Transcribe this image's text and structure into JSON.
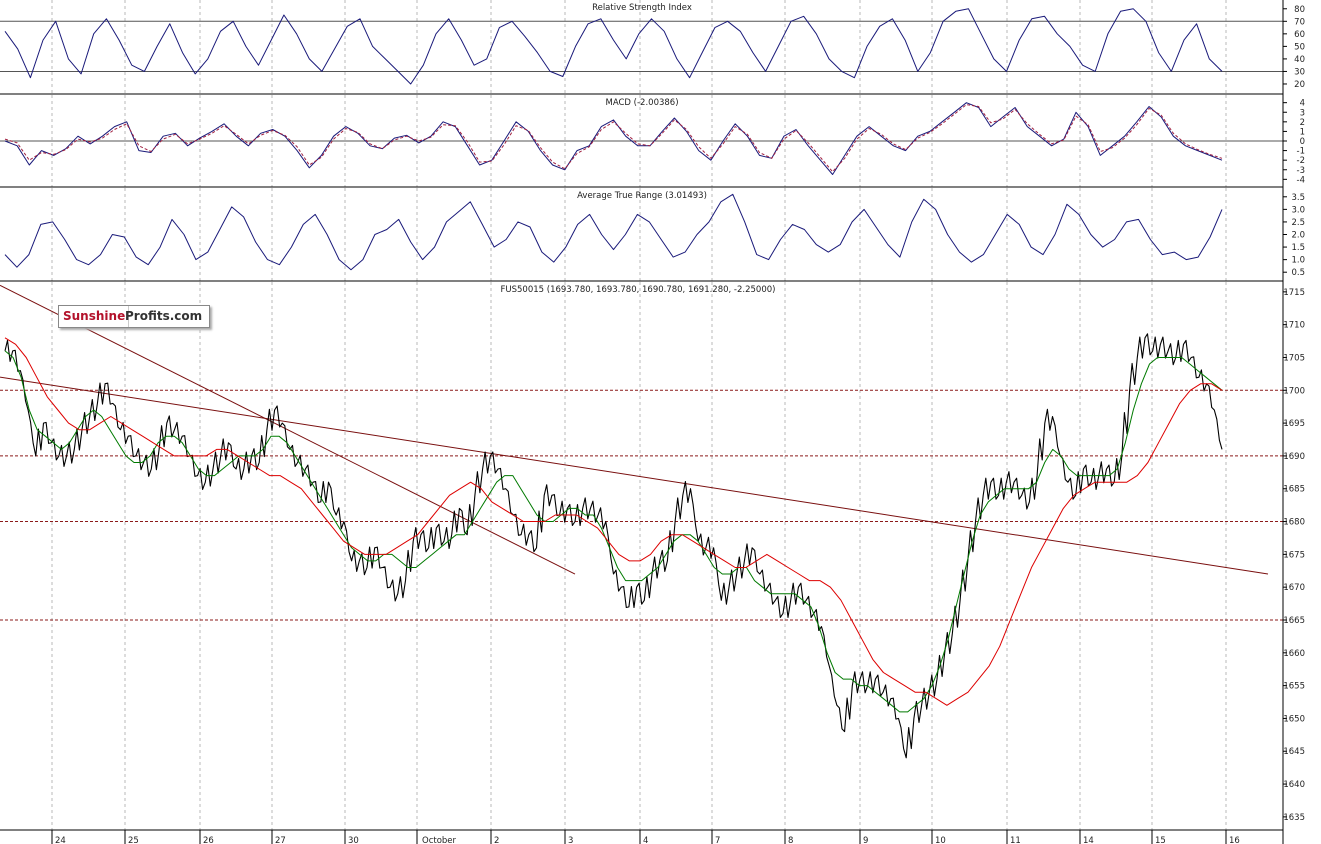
{
  "chart_data": [
    {
      "type": "line",
      "title": "Relative Strength Index",
      "yticks": [
        20,
        30,
        40,
        50,
        60,
        70,
        80
      ],
      "ylim": [
        12,
        87
      ],
      "reference_lines": [
        30,
        70
      ],
      "series": [
        {
          "color": "#1a1a7a",
          "values": [
            62,
            48,
            25,
            55,
            70,
            40,
            28,
            60,
            72,
            55,
            35,
            30,
            50,
            68,
            45,
            28,
            40,
            62,
            70,
            50,
            35,
            55,
            75,
            60,
            40,
            30,
            48,
            66,
            72,
            50,
            40,
            30,
            20,
            35,
            60,
            72,
            55,
            35,
            40,
            65,
            70,
            58,
            45,
            30,
            26,
            50,
            68,
            72,
            55,
            40,
            60,
            72,
            62,
            40,
            25,
            45,
            65,
            70,
            62,
            45,
            30,
            50,
            70,
            74,
            60,
            40,
            30,
            25,
            50,
            66,
            72,
            55,
            30,
            45,
            70,
            78,
            80,
            60,
            40,
            30,
            55,
            72,
            74,
            60,
            50,
            35,
            30,
            60,
            78,
            80,
            70,
            45,
            30,
            55,
            68,
            40,
            30
          ]
        }
      ]
    },
    {
      "type": "line",
      "title": "MACD (-2.00386)",
      "yticks": [
        -4,
        -3,
        -2,
        -1,
        0,
        1,
        2,
        3,
        4
      ],
      "ylim": [
        -4.8,
        4.8
      ],
      "reference_lines": [
        0
      ],
      "series": [
        {
          "color": "#1a1a7a",
          "values": [
            0,
            -0.5,
            -2.5,
            -1,
            -1.5,
            -0.8,
            0.5,
            -0.3,
            0.5,
            1.5,
            2,
            -1,
            -1.2,
            0.5,
            0.8,
            -0.5,
            0.3,
            1,
            1.8,
            0.5,
            -0.5,
            0.8,
            1.2,
            0.5,
            -1,
            -2.8,
            -1.5,
            0.5,
            1.5,
            0.8,
            -0.5,
            -0.8,
            0.3,
            0.6,
            -0.2,
            0.5,
            2,
            1.5,
            -0.5,
            -2.5,
            -2,
            0,
            2,
            1,
            -1,
            -2.5,
            -3,
            -1,
            -0.5,
            1.5,
            2.2,
            0.5,
            -0.5,
            -0.5,
            1,
            2.4,
            1,
            -1,
            -2,
            0,
            1.8,
            0.5,
            -1.5,
            -1.8,
            0.5,
            1.2,
            -0.5,
            -2,
            -3.5,
            -1.5,
            0.5,
            1.5,
            0.5,
            -0.5,
            -1,
            0.5,
            1,
            2,
            3,
            4,
            3.5,
            1.5,
            2.5,
            3.5,
            1.5,
            0.5,
            -0.5,
            0.2,
            3,
            1.5,
            -1.5,
            -0.5,
            0.5,
            2,
            3.6,
            2.5,
            0.5,
            -0.5,
            -1,
            -1.5,
            -2
          ]
        },
        {
          "color": "#a02040",
          "values": [
            0.2,
            -0.2,
            -2,
            -1.2,
            -1.4,
            -0.9,
            0.2,
            -0.1,
            0.3,
            1.2,
            1.8,
            -0.5,
            -1.1,
            0.2,
            0.7,
            -0.3,
            0.2,
            0.8,
            1.6,
            0.7,
            -0.3,
            0.6,
            1.1,
            0.6,
            -0.6,
            -2.5,
            -1.7,
            0.2,
            1.3,
            0.9,
            -0.3,
            -0.8,
            0.1,
            0.5,
            0,
            0.4,
            1.7,
            1.6,
            -0.1,
            -2.2,
            -2.1,
            -0.4,
            1.6,
            1.1,
            -0.7,
            -2.2,
            -2.9,
            -1.3,
            -0.6,
            1.2,
            2,
            0.8,
            -0.3,
            -0.5,
            0.8,
            2.2,
            1.2,
            -0.6,
            -1.8,
            -0.3,
            1.5,
            0.7,
            -1.2,
            -1.8,
            0.2,
            1.1,
            -0.2,
            -1.7,
            -3.2,
            -1.8,
            0.2,
            1.3,
            0.7,
            -0.3,
            -0.9,
            0.3,
            0.9,
            1.8,
            2.8,
            3.8,
            3.6,
            1.9,
            2.3,
            3.3,
            1.8,
            0.7,
            -0.3,
            0.1,
            2.6,
            1.7,
            -1.1,
            -0.7,
            0.3,
            1.7,
            3.4,
            2.7,
            0.8,
            -0.3,
            -0.9,
            -1.4,
            -1.8
          ]
        }
      ]
    },
    {
      "type": "line",
      "title": "Average True Range (3.01493)",
      "yticks": [
        0.5,
        1.0,
        1.5,
        2.0,
        2.5,
        3.0,
        3.5
      ],
      "ylim": [
        0.15,
        3.85
      ],
      "series": [
        {
          "color": "#1a1a7a",
          "values": [
            1.2,
            0.7,
            1.2,
            2.4,
            2.5,
            1.8,
            1.0,
            0.8,
            1.2,
            2.0,
            1.9,
            1.1,
            0.8,
            1.5,
            2.6,
            2.0,
            1.0,
            1.3,
            2.2,
            3.1,
            2.7,
            1.7,
            1.0,
            0.8,
            1.5,
            2.4,
            2.8,
            2.0,
            1.0,
            0.6,
            1.0,
            2.0,
            2.2,
            2.6,
            1.7,
            1.0,
            1.5,
            2.5,
            2.9,
            3.3,
            2.4,
            1.5,
            1.8,
            2.5,
            2.3,
            1.3,
            0.9,
            1.5,
            2.4,
            2.8,
            2.0,
            1.4,
            2.0,
            2.8,
            2.5,
            1.8,
            1.1,
            1.3,
            2.0,
            2.5,
            3.3,
            3.6,
            2.5,
            1.2,
            1.0,
            1.8,
            2.4,
            2.2,
            1.6,
            1.3,
            1.6,
            2.5,
            3.0,
            2.3,
            1.6,
            1.1,
            2.5,
            3.4,
            3.0,
            2.0,
            1.3,
            0.9,
            1.2,
            2.0,
            2.8,
            2.4,
            1.5,
            1.2,
            2.0,
            3.2,
            2.8,
            2.0,
            1.5,
            1.8,
            2.5,
            2.6,
            1.8,
            1.2,
            1.3,
            1.0,
            1.1,
            1.9,
            3.0
          ]
        }
      ]
    },
    {
      "type": "line",
      "title": "FUS50015 (1693.780, 1693.780, 1690.780, 1691.280, -2.25000)",
      "yticks": [
        1635,
        1640,
        1645,
        1650,
        1655,
        1660,
        1665,
        1670,
        1675,
        1680,
        1685,
        1690,
        1695,
        1700,
        1705,
        1710,
        1715
      ],
      "ylim": [
        1633,
        1716.5
      ],
      "x_labels": [
        "24",
        "25",
        "26",
        "27",
        "30",
        "October",
        "2",
        "3",
        "4",
        "7",
        "8",
        "9",
        "10",
        "11",
        "14",
        "15",
        "16"
      ],
      "horizontal_levels": [
        1665,
        1680,
        1690,
        1700
      ],
      "trendlines": [
        {
          "from": [
            "23",
            1716
          ],
          "to": [
            "3",
            1672
          ]
        },
        {
          "from": [
            "23",
            1702
          ],
          "to": [
            "16",
            1672
          ]
        }
      ],
      "series": [
        {
          "color": "#000000",
          "values": [
            1706,
            1706,
            1703,
            1697,
            1690,
            1695,
            1692,
            1690,
            1690,
            1691,
            1694,
            1696,
            1698,
            1701,
            1698,
            1694,
            1693,
            1690,
            1689,
            1688,
            1691,
            1695,
            1694,
            1693,
            1690,
            1687,
            1686,
            1688,
            1690,
            1692,
            1688,
            1688,
            1690,
            1689,
            1694,
            1697,
            1695,
            1691,
            1689,
            1688,
            1686,
            1683,
            1686,
            1681,
            1680,
            1674,
            1674,
            1673,
            1676,
            1673,
            1670,
            1669,
            1671,
            1677,
            1678,
            1676,
            1679,
            1677,
            1678,
            1682,
            1678,
            1684,
            1688,
            1690,
            1688,
            1685,
            1681,
            1678,
            1678,
            1676,
            1684,
            1684,
            1681,
            1682,
            1680,
            1682,
            1682,
            1681,
            1680,
            1672,
            1670,
            1667,
            1670,
            1668,
            1672,
            1674,
            1674,
            1680,
            1684,
            1685,
            1677,
            1676,
            1676,
            1668,
            1670,
            1672,
            1674,
            1676,
            1672,
            1670,
            1668,
            1666,
            1668,
            1670,
            1668,
            1666,
            1664,
            1658,
            1652,
            1648,
            1655,
            1656,
            1655,
            1656,
            1654,
            1653,
            1650,
            1644,
            1650,
            1652,
            1654,
            1656,
            1660,
            1663,
            1668,
            1674,
            1680,
            1684,
            1686,
            1684,
            1686,
            1686,
            1684,
            1683,
            1687,
            1695,
            1696,
            1690,
            1686,
            1684,
            1688,
            1686,
            1687,
            1688,
            1686,
            1690,
            1700,
            1705,
            1708,
            1706,
            1707,
            1706,
            1705,
            1707,
            1705,
            1702,
            1701,
            1697,
            1691
          ]
        },
        {
          "color": "#007a00",
          "values": [
            1706,
            1705,
            1702,
            1697,
            1694,
            1693,
            1692,
            1691,
            1692,
            1694,
            1696,
            1697,
            1696,
            1694,
            1692,
            1690,
            1689,
            1689,
            1690,
            1692,
            1693,
            1693,
            1692,
            1690,
            1688,
            1687,
            1687,
            1688,
            1689,
            1690,
            1690,
            1690,
            1691,
            1693,
            1693,
            1692,
            1690,
            1688,
            1686,
            1684,
            1682,
            1680,
            1678,
            1676,
            1675,
            1674,
            1674,
            1675,
            1675,
            1674,
            1673,
            1673,
            1674,
            1675,
            1676,
            1677,
            1678,
            1678,
            1680,
            1682,
            1684,
            1686,
            1687,
            1687,
            1685,
            1683,
            1681,
            1680,
            1680,
            1681,
            1682,
            1682,
            1681,
            1681,
            1679,
            1676,
            1673,
            1671,
            1671,
            1671,
            1672,
            1673,
            1675,
            1677,
            1678,
            1678,
            1677,
            1675,
            1673,
            1672,
            1672,
            1673,
            1673,
            1671,
            1670,
            1669,
            1669,
            1669,
            1669,
            1668,
            1667,
            1664,
            1660,
            1657,
            1656,
            1656,
            1655,
            1655,
            1654,
            1653,
            1652,
            1651,
            1651,
            1652,
            1653,
            1655,
            1658,
            1662,
            1667,
            1672,
            1677,
            1681,
            1683,
            1684,
            1685,
            1685,
            1685,
            1685,
            1686,
            1689,
            1691,
            1690,
            1688,
            1687,
            1687,
            1687,
            1687,
            1687,
            1688,
            1692,
            1697,
            1701,
            1704,
            1705,
            1705,
            1705,
            1705,
            1704,
            1703,
            1702,
            1701,
            1700
          ]
        },
        {
          "color": "#dd0000",
          "values": [
            1708,
            1707,
            1705,
            1702,
            1699,
            1697,
            1695,
            1694,
            1694,
            1695,
            1696,
            1695,
            1694,
            1693,
            1692,
            1691,
            1690,
            1690,
            1690,
            1690,
            1691,
            1691,
            1690,
            1689,
            1688,
            1687,
            1687,
            1686,
            1685,
            1683,
            1681,
            1679,
            1677,
            1676,
            1675,
            1675,
            1675,
            1676,
            1677,
            1678,
            1680,
            1682,
            1684,
            1685,
            1686,
            1685,
            1683,
            1682,
            1681,
            1680,
            1680,
            1680,
            1681,
            1681,
            1681,
            1680,
            1679,
            1677,
            1675,
            1674,
            1674,
            1675,
            1677,
            1678,
            1678,
            1677,
            1676,
            1675,
            1674,
            1673,
            1673,
            1674,
            1675,
            1674,
            1673,
            1672,
            1671,
            1671,
            1670,
            1668,
            1665,
            1662,
            1659,
            1657,
            1656,
            1655,
            1654,
            1654,
            1653,
            1652,
            1653,
            1654,
            1656,
            1658,
            1661,
            1665,
            1669,
            1673,
            1676,
            1679,
            1682,
            1684,
            1685,
            1686,
            1686,
            1686,
            1686,
            1687,
            1689,
            1692,
            1695,
            1698,
            1700,
            1701,
            1701,
            1700
          ]
        }
      ]
    }
  ],
  "logo": {
    "part1": "Sunshine",
    "part2": "Profits.com"
  }
}
